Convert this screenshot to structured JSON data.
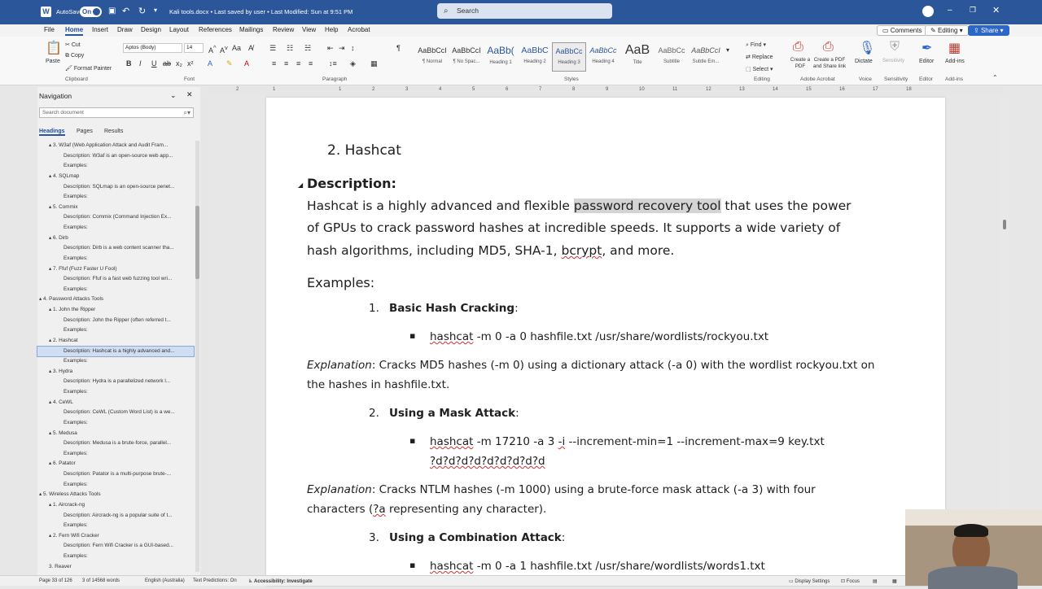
{
  "title_bar": {
    "autosave_label": "AutoSave",
    "autosave_state": "On",
    "doc_title": "Kali tools.docx  •  Last saved by user  •  Last Modified: Sun at 9:51 PM",
    "search_placeholder": "Search"
  },
  "tabs": [
    "File",
    "Home",
    "Insert",
    "Draw",
    "Design",
    "Layout",
    "References",
    "Mailings",
    "Review",
    "View",
    "Help",
    "Acrobat"
  ],
  "top_right": {
    "comments": "Comments",
    "editing": "Editing",
    "share": "Share"
  },
  "ribbon": {
    "clipboard": {
      "paste": "Paste",
      "cut": "Cut",
      "copy": "Copy",
      "format_painter": "Format Painter",
      "group": "Clipboard"
    },
    "font": {
      "name": "Aptos (Body)",
      "size": "14",
      "group": "Font"
    },
    "paragraph_group": "Paragraph",
    "styles": [
      {
        "preview": "AaBbCcI",
        "name": "¶ Normal"
      },
      {
        "preview": "AaBbCcI",
        "name": "¶ No Spac..."
      },
      {
        "preview": "AaBb(",
        "name": "Heading 1"
      },
      {
        "preview": "AaBbC",
        "name": "Heading 2"
      },
      {
        "preview": "AaBbCc",
        "name": "Heading 3"
      },
      {
        "preview": "AaBbCc",
        "name": "Heading 4"
      },
      {
        "preview": "AaB",
        "name": "Title"
      },
      {
        "preview": "AaBbCc",
        "name": "Subtitle"
      },
      {
        "preview": "AaBbCcI",
        "name": "Subtle Em..."
      }
    ],
    "styles_group": "Styles",
    "editing": {
      "find": "Find",
      "replace": "Replace",
      "select": "Select",
      "group": "Editing"
    },
    "acrobat": {
      "create_pdf": "Create a PDF",
      "create_share": "Create a PDF and Share link",
      "group": "Adobe Acrobat"
    },
    "voice": {
      "dictate": "Dictate",
      "group": "Voice"
    },
    "sensitivity": {
      "label": "Sensitivity",
      "group": "Sensitivity"
    },
    "editor": {
      "label": "Editor",
      "group": "Editor"
    },
    "addins": {
      "label": "Add-ins",
      "group": "Add-ins"
    }
  },
  "navigation": {
    "title": "Navigation",
    "search_placeholder": "Search document",
    "tabs": [
      "Headings",
      "Pages",
      "Results"
    ],
    "items": [
      {
        "text": "▴ 3. W3af (Web Application Attack and Audit Fram...",
        "indent": 2
      },
      {
        "text": "Description:  W3af is an open-source web app...",
        "indent": 3
      },
      {
        "text": "Examples:",
        "indent": 3
      },
      {
        "text": "▴ 4. SQLmap",
        "indent": 2
      },
      {
        "text": "Description:  SQLmap is an open-source penet...",
        "indent": 3
      },
      {
        "text": "Examples:",
        "indent": 3
      },
      {
        "text": "▴ 5. Commix",
        "indent": 2
      },
      {
        "text": "Description:  Commix (Command Injection Ex...",
        "indent": 3
      },
      {
        "text": "Examples:",
        "indent": 3
      },
      {
        "text": "▴ 6. Dirb",
        "indent": 2
      },
      {
        "text": "Description:  Dirb is a web content scanner tha...",
        "indent": 3
      },
      {
        "text": "Examples:",
        "indent": 3
      },
      {
        "text": "▴ 7. Ffuf (Fuzz Faster U Fool)",
        "indent": 2
      },
      {
        "text": "Description:  Ffuf is a fast web fuzzing tool wri...",
        "indent": 3
      },
      {
        "text": "Examples:",
        "indent": 3
      },
      {
        "text": "▴ 4. Password Attacks Tools",
        "indent": 1
      },
      {
        "text": "▴ 1. John the Ripper",
        "indent": 2
      },
      {
        "text": "Description:  John the Ripper (often referred t...",
        "indent": 3
      },
      {
        "text": "Examples:",
        "indent": 3
      },
      {
        "text": "▴ 2. Hashcat",
        "indent": 2
      },
      {
        "text": "Description:  Hashcat is a highly advanced and...",
        "indent": 3,
        "selected": true
      },
      {
        "text": "Examples:",
        "indent": 3
      },
      {
        "text": "▴ 3. Hydra",
        "indent": 2
      },
      {
        "text": "Description:  Hydra is a parallelized network l...",
        "indent": 3
      },
      {
        "text": "Examples:",
        "indent": 3
      },
      {
        "text": "▴ 4. CeWL",
        "indent": 2
      },
      {
        "text": "Description:  CeWL (Custom Word List) is a we...",
        "indent": 3
      },
      {
        "text": "Examples:",
        "indent": 3
      },
      {
        "text": "▴ 5. Medusa",
        "indent": 2
      },
      {
        "text": "Description:  Medusa is a brute-force, parallel...",
        "indent": 3
      },
      {
        "text": "Examples:",
        "indent": 3
      },
      {
        "text": "▴ 6. Patator",
        "indent": 2
      },
      {
        "text": "Description:  Patator is a multi-purpose brute-...",
        "indent": 3
      },
      {
        "text": "Examples:",
        "indent": 3
      },
      {
        "text": "▴ 5. Wireless Attacks Tools",
        "indent": 1
      },
      {
        "text": "▴ 1. Aircrack-ng",
        "indent": 2
      },
      {
        "text": "Description:  Aircrack-ng is a popular suite of t...",
        "indent": 3
      },
      {
        "text": "Examples:",
        "indent": 3
      },
      {
        "text": "▴ 2. Fern Wifi Cracker",
        "indent": 2
      },
      {
        "text": "Description:  Fern Wifi Cracker is a GUI-based...",
        "indent": 3
      },
      {
        "text": "Examples:",
        "indent": 3
      },
      {
        "text": "3. Reaver",
        "indent": 2
      }
    ]
  },
  "document": {
    "heading": "2.  Hashcat",
    "desc_label": "Description:",
    "desc_line1_a": "Hashcat is a highly advanced and flexible ",
    "desc_line1_hl": "password recovery tool",
    "desc_line1_b": " that uses the power",
    "desc_line2": "of GPUs to crack password hashes at incredible speeds. It supports a wide variety of",
    "desc_line3_a": "hash algorithms, including MD5, SHA-1, ",
    "desc_line3_sq": "bcrypt",
    "desc_line3_b": ", and more.",
    "examples_label": "Examples:",
    "ex1_num": "1.",
    "ex1_title": "Basic Hash Cracking",
    "ex1_colon": ":",
    "ex1_cmd_a": "hashcat",
    "ex1_cmd_b": " -m 0 -a 0 hashfile.txt /usr/share/wordlists/rockyou.txt",
    "ex1_expl_label": "Explanation",
    "ex1_expl_1": ": Cracks MD5 hashes (-m 0) using a dictionary attack (-a 0) with the wordlist rockyou.txt on",
    "ex1_expl_2": "the hashes in hashfile.txt.",
    "ex2_num": "2.",
    "ex2_title": "Using a Mask Attack",
    "ex2_colon": ":",
    "ex2_cmd_a": "hashcat",
    "ex2_cmd_b": " -m 17210 -a 3 ",
    "ex2_cmd_sq": "-i",
    "ex2_cmd_c": " --increment-min=1 --increment-max=9 key.txt",
    "ex2_cmd_2": "?d?d?d?d?d?d?d?d?d",
    "ex2_expl_label": "Explanation",
    "ex2_expl_1": ": Cracks NTLM hashes (-m 1000) using a brute-force mask attack (-a 3) with four",
    "ex2_expl_2a": "characters (",
    "ex2_expl_2sq": "?a",
    "ex2_expl_2b": " representing any character).",
    "ex3_num": "3.",
    "ex3_title": "Using a Combination Attack",
    "ex3_colon": ":",
    "ex3_cmd_a": "hashcat",
    "ex3_cmd_b": " -m 0 -a 1 hashfile.txt /usr/share/wordlists/words1.txt",
    "bullet": "▪"
  },
  "status_bar": {
    "page": "Page 33 of 126",
    "words": "3 of 14568 words",
    "language": "English (Australia)",
    "predictions": "Text Predictions: On",
    "accessibility": "Accessibility: Investigate",
    "display": "Display Settings",
    "focus": "Focus"
  },
  "ruler_numbers": [
    "2",
    "1",
    "1",
    "2",
    "3",
    "4",
    "5",
    "6",
    "7",
    "8",
    "9",
    "10",
    "11",
    "12",
    "13",
    "14",
    "15",
    "16",
    "17",
    "18"
  ]
}
